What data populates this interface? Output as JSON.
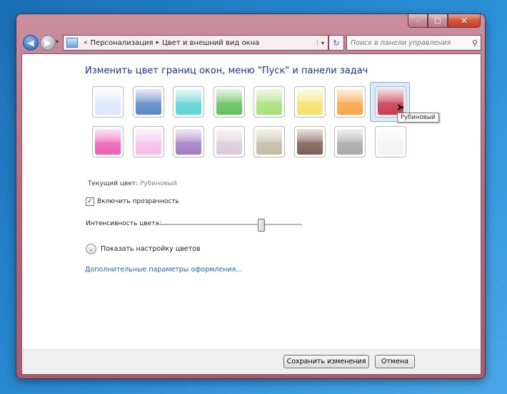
{
  "window": {
    "caption_buttons": {
      "minimize": "–",
      "maximize": "□",
      "close": "✕"
    }
  },
  "navbar": {
    "back_glyph": "◀",
    "forward_glyph": "▶",
    "dropdown_glyph": "▾",
    "address_sep_start": "«",
    "breadcrumb": [
      "Персонализация",
      "Цвет и внешний вид окна"
    ],
    "breadcrumb_sep": "▸",
    "address_dropdown": "▾",
    "refresh_glyph": "↻",
    "search_placeholder": "Поиск в панели управления",
    "search_icon": "⚲"
  },
  "main": {
    "title": "Изменить цвет границ окон, меню \"Пуск\" и панели задач",
    "swatches_row1": [
      "#d9e8fb",
      "#5b86c9",
      "#5dd3d6",
      "#62c15c",
      "#a6e078",
      "#f7e06a",
      "#f8a443",
      "#cd3a4b"
    ],
    "swatches_row2": [
      "#ee5eb6",
      "#f6bde9",
      "#a07cc4",
      "#ddc9d9",
      "#c6baa4",
      "#7e5c55",
      "#a8a8a8",
      "#f3f3f3"
    ],
    "selected_index": 7,
    "tooltip": "Рубиновый",
    "current_color_label": "Текущий цвет:",
    "current_color_value": "Рубиновый",
    "transparency_label": "Включить прозрачность",
    "transparency_checked": true,
    "check_glyph": "✓",
    "intensity_label": "Интенсивность цвета:",
    "intensity_value_fraction": 0.72,
    "expand_glyph": "⌄",
    "show_mixer_label": "Показать настройку цветов",
    "advanced_link": "Дополнительные параметры оформления..."
  },
  "footer": {
    "save_label": "Сохранить изменения",
    "cancel_label": "Отмена"
  }
}
